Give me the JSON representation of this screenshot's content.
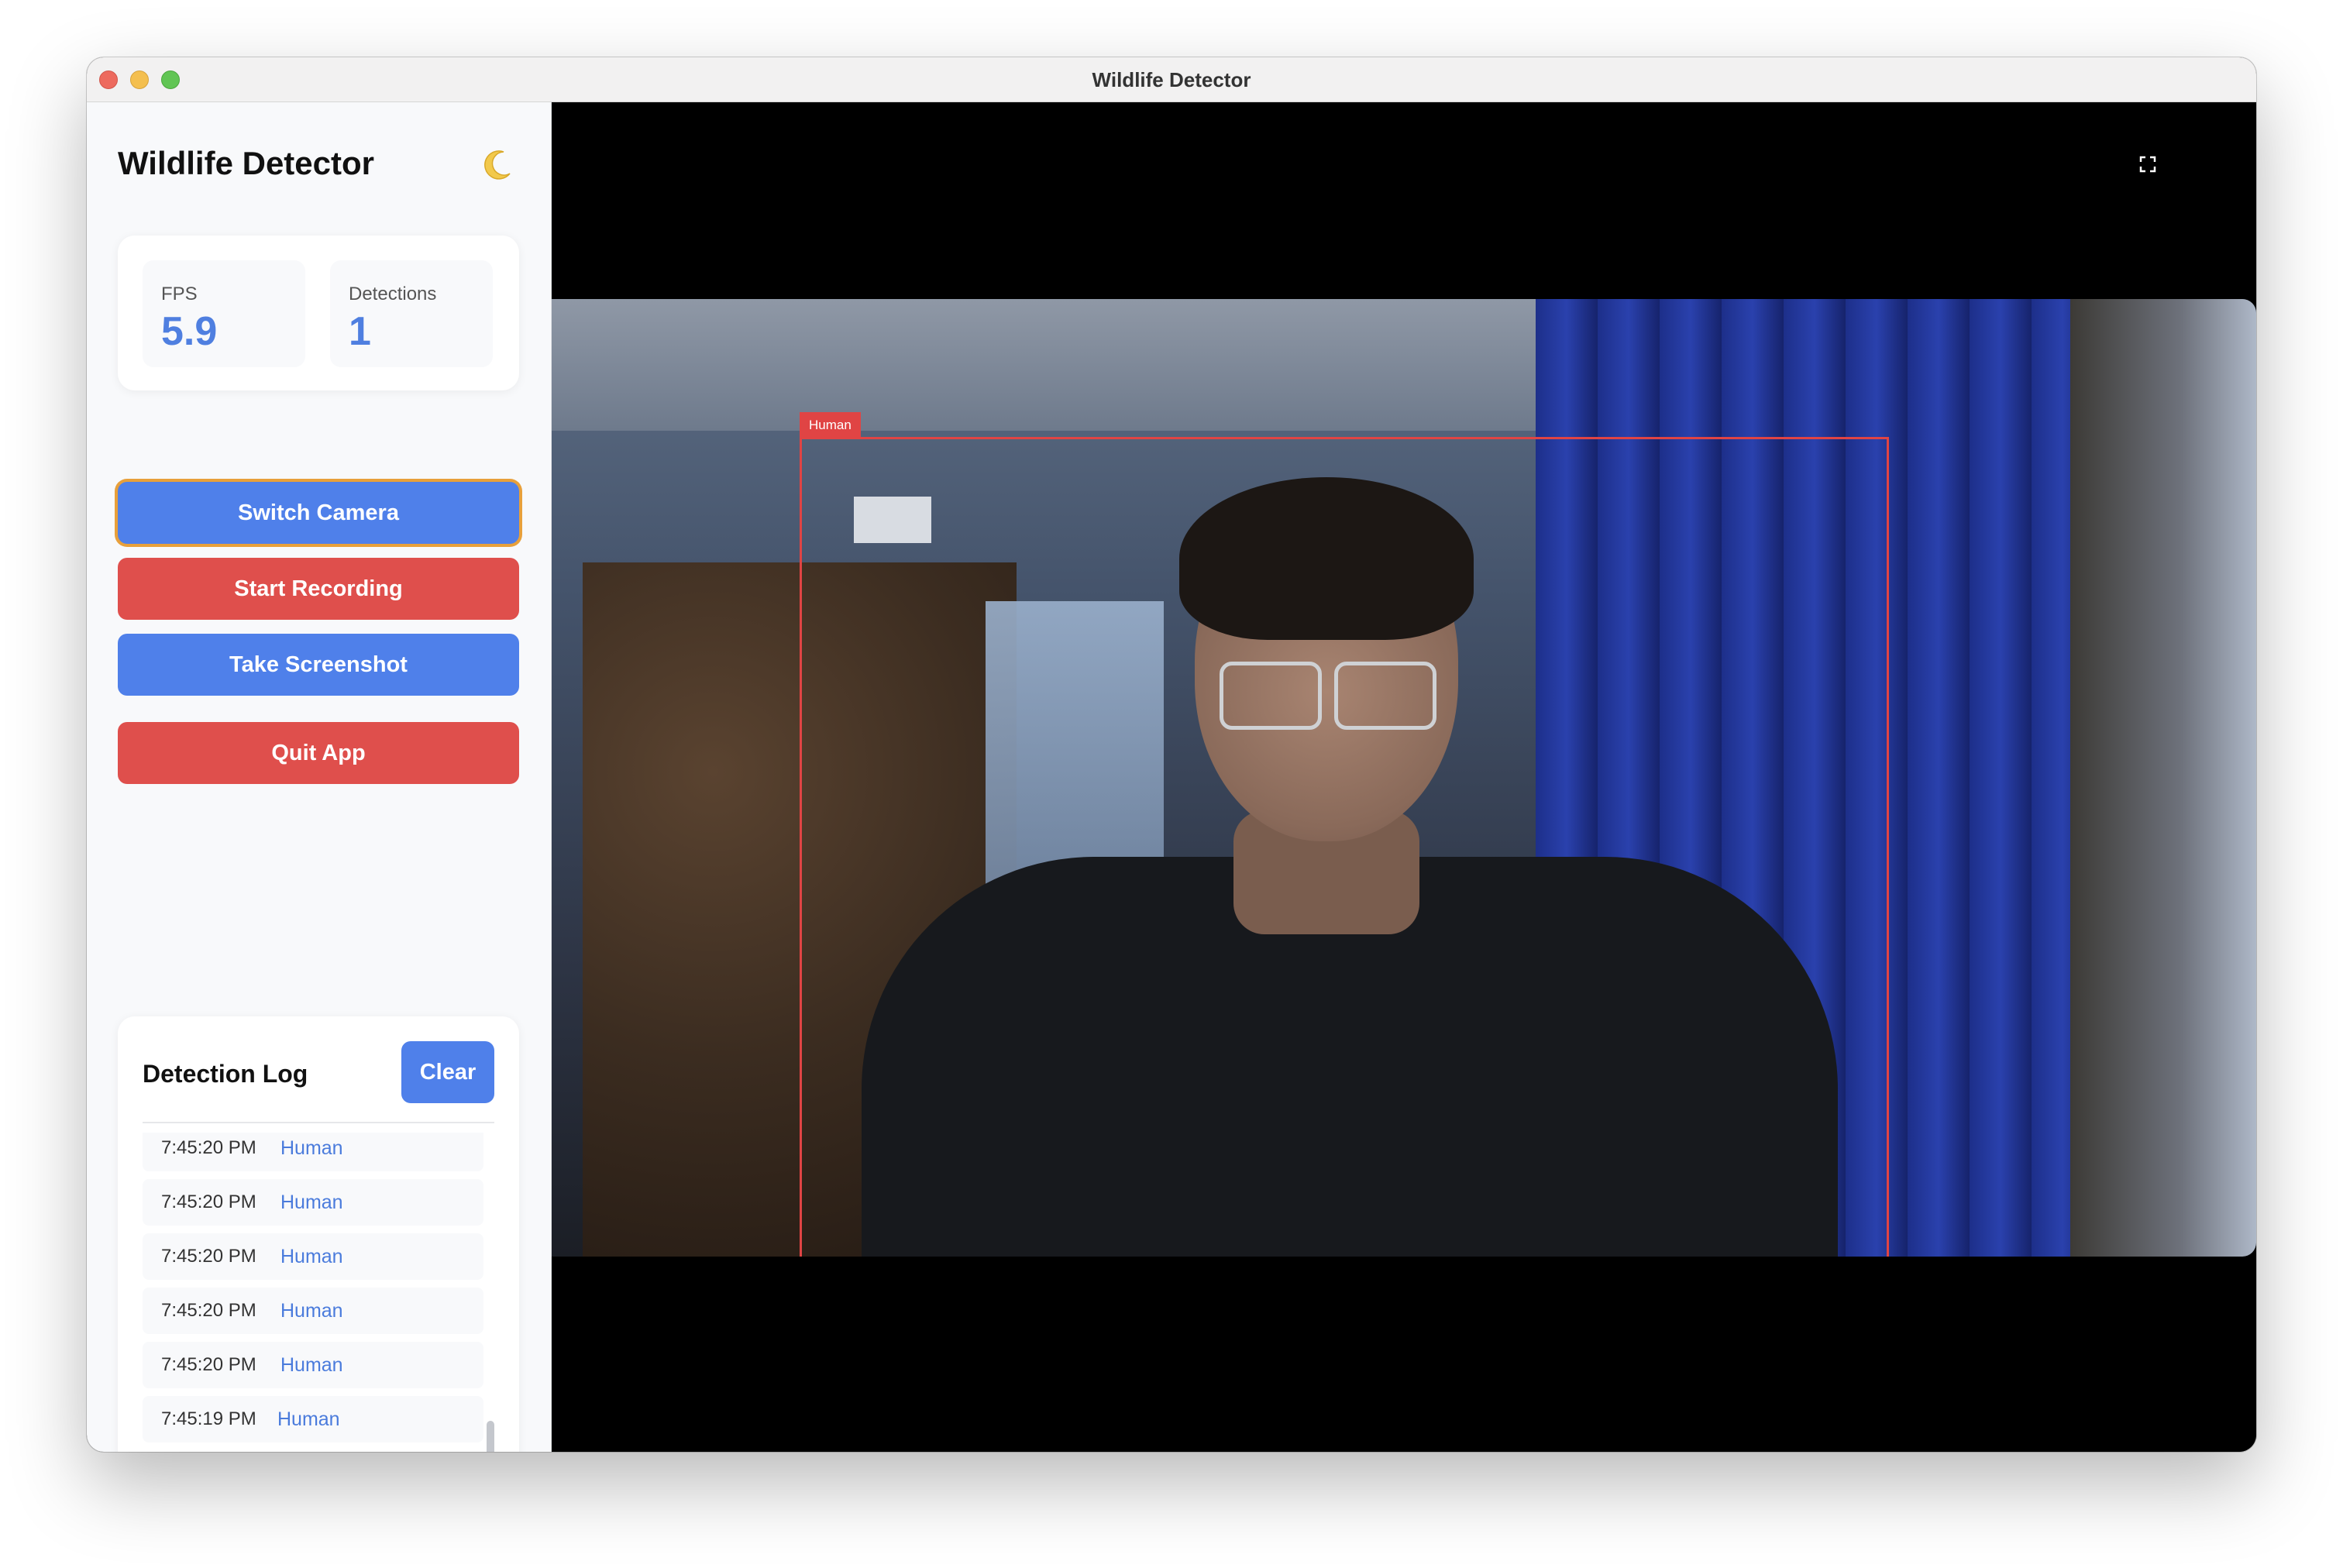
{
  "window": {
    "title": "Wildlife Detector"
  },
  "sidebar": {
    "title": "Wildlife Detector",
    "theme_icon": "moon-icon",
    "stats": {
      "fps_label": "FPS",
      "fps_value": "5.9",
      "detections_label": "Detections",
      "detections_value": "1"
    },
    "buttons": {
      "switch_camera": "Switch Camera",
      "start_recording": "Start Recording",
      "take_screenshot": "Take Screenshot",
      "quit_app": "Quit App"
    },
    "log": {
      "title": "Detection Log",
      "clear_label": "Clear",
      "entries": [
        {
          "time": "7:45:20 PM",
          "label": "Human"
        },
        {
          "time": "7:45:20 PM",
          "label": "Human"
        },
        {
          "time": "7:45:20 PM",
          "label": "Human"
        },
        {
          "time": "7:45:20 PM",
          "label": "Human"
        },
        {
          "time": "7:45:20 PM",
          "label": "Human"
        },
        {
          "time": "7:45:19 PM",
          "label": "Human"
        }
      ]
    }
  },
  "video": {
    "fullscreen_icon": "fullscreen-icon",
    "detection": {
      "label": "Human"
    }
  },
  "colors": {
    "primary_blue": "#4f80ea",
    "danger_red": "#df4f4c",
    "stat_value_blue": "#4f7fe0",
    "bbox_red": "#e04444",
    "log_label_blue": "#4a7bdc",
    "focus_ring": "#e8a03b"
  }
}
